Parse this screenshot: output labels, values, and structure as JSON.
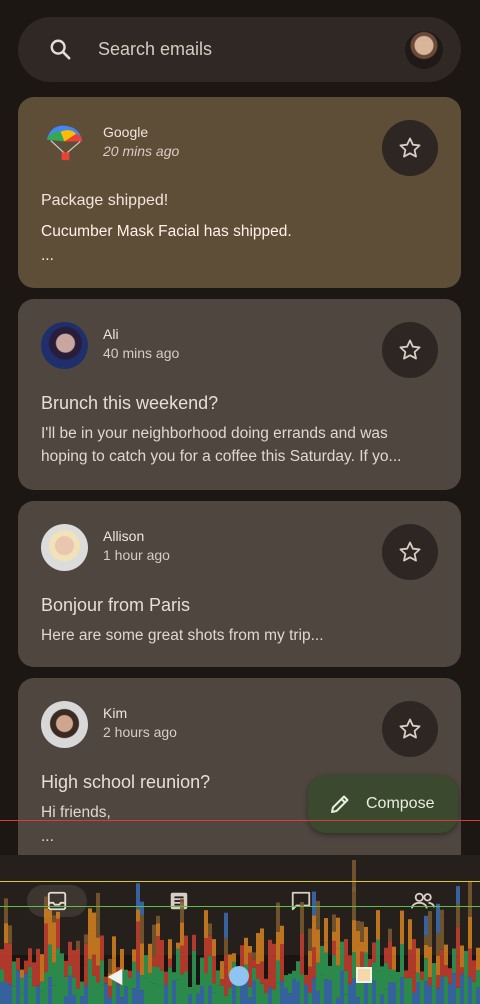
{
  "search": {
    "placeholder": "Search emails",
    "icon": "search-icon"
  },
  "emails": [
    {
      "sender": "Google",
      "time": "20 mins ago",
      "subject": "Package shipped!",
      "preview": "Cucumber Mask Facial has shipped.",
      "ellipsis": "..."
    },
    {
      "sender": "Ali",
      "time": "40 mins ago",
      "subject": "Brunch this weekend?",
      "preview": "I'll be in your neighborhood doing errands and was hoping to catch you for a coffee this Saturday. If yo..."
    },
    {
      "sender": "Allison",
      "time": "1 hour ago",
      "subject": "Bonjour from Paris",
      "preview": "Here are some great shots from my trip..."
    },
    {
      "sender": "Kim",
      "time": "2 hours ago",
      "subject": "High school reunion?",
      "preview": "Hi friends,",
      "ellipsis": "..."
    }
  ],
  "fab": {
    "label": "Compose"
  },
  "colors": {
    "background": "#1d1714",
    "card": "#4f4640",
    "highlight_card": "#5e4d37",
    "fab": "#3b4a2f"
  }
}
